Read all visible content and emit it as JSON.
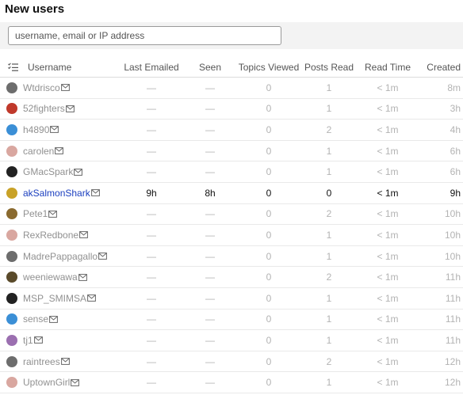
{
  "page_title": "New users",
  "search": {
    "placeholder": "username, email or IP address",
    "value": ""
  },
  "columns": {
    "username": "Username",
    "last_emailed": "Last Emailed",
    "seen": "Seen",
    "topics_viewed": "Topics Viewed",
    "posts_read": "Posts Read",
    "read_time": "Read Time",
    "created": "Created"
  },
  "icons": {
    "bulk_select": "bulk-select-icon",
    "email": "envelope-icon"
  },
  "users": [
    {
      "username": "Wtdrisco",
      "last_emailed": "—",
      "seen": "—",
      "topics_viewed": "0",
      "posts_read": "1",
      "read_time": "< 1m",
      "created": "8m",
      "avatar_color": "#6d6d6d"
    },
    {
      "username": "52fighters",
      "last_emailed": "—",
      "seen": "—",
      "topics_viewed": "0",
      "posts_read": "1",
      "read_time": "< 1m",
      "created": "3h",
      "avatar_color": "#c0392b"
    },
    {
      "username": "h4890",
      "last_emailed": "—",
      "seen": "—",
      "topics_viewed": "0",
      "posts_read": "2",
      "read_time": "< 1m",
      "created": "4h",
      "avatar_color": "#3b8fd6"
    },
    {
      "username": "carolen",
      "last_emailed": "—",
      "seen": "—",
      "topics_viewed": "0",
      "posts_read": "1",
      "read_time": "< 1m",
      "created": "6h",
      "avatar_color": "#d9a7a0"
    },
    {
      "username": "GMacSpark",
      "last_emailed": "—",
      "seen": "—",
      "topics_viewed": "0",
      "posts_read": "1",
      "read_time": "< 1m",
      "created": "6h",
      "avatar_color": "#222222"
    },
    {
      "username": "akSalmonShark",
      "last_emailed": "9h",
      "seen": "8h",
      "topics_viewed": "0",
      "posts_read": "0",
      "read_time": "< 1m",
      "created": "9h",
      "avatar_color": "#c9a227",
      "active": true
    },
    {
      "username": "Pete1",
      "last_emailed": "—",
      "seen": "—",
      "topics_viewed": "0",
      "posts_read": "2",
      "read_time": "< 1m",
      "created": "10h",
      "avatar_color": "#8a6a2f"
    },
    {
      "username": "RexRedbone",
      "last_emailed": "—",
      "seen": "—",
      "topics_viewed": "0",
      "posts_read": "1",
      "read_time": "< 1m",
      "created": "10h",
      "avatar_color": "#d9a7a0"
    },
    {
      "username": "MadrePappagallo",
      "last_emailed": "—",
      "seen": "—",
      "topics_viewed": "0",
      "posts_read": "1",
      "read_time": "< 1m",
      "created": "10h",
      "avatar_color": "#6d6d6d"
    },
    {
      "username": "weeniewawa",
      "last_emailed": "—",
      "seen": "—",
      "topics_viewed": "0",
      "posts_read": "2",
      "read_time": "< 1m",
      "created": "11h",
      "avatar_color": "#5a4a2a"
    },
    {
      "username": "MSP_SMIMSA",
      "last_emailed": "—",
      "seen": "—",
      "topics_viewed": "0",
      "posts_read": "1",
      "read_time": "< 1m",
      "created": "11h",
      "avatar_color": "#222222"
    },
    {
      "username": "sense",
      "last_emailed": "—",
      "seen": "—",
      "topics_viewed": "0",
      "posts_read": "1",
      "read_time": "< 1m",
      "created": "11h",
      "avatar_color": "#3b8fd6"
    },
    {
      "username": "tj1",
      "last_emailed": "—",
      "seen": "—",
      "topics_viewed": "0",
      "posts_read": "1",
      "read_time": "< 1m",
      "created": "11h",
      "avatar_color": "#9b6fb0"
    },
    {
      "username": "raintrees",
      "last_emailed": "—",
      "seen": "—",
      "topics_viewed": "0",
      "posts_read": "2",
      "read_time": "< 1m",
      "created": "12h",
      "avatar_color": "#6d6d6d"
    },
    {
      "username": "UptownGirl",
      "last_emailed": "—",
      "seen": "—",
      "topics_viewed": "0",
      "posts_read": "1",
      "read_time": "< 1m",
      "created": "12h",
      "avatar_color": "#d9a7a0"
    }
  ]
}
